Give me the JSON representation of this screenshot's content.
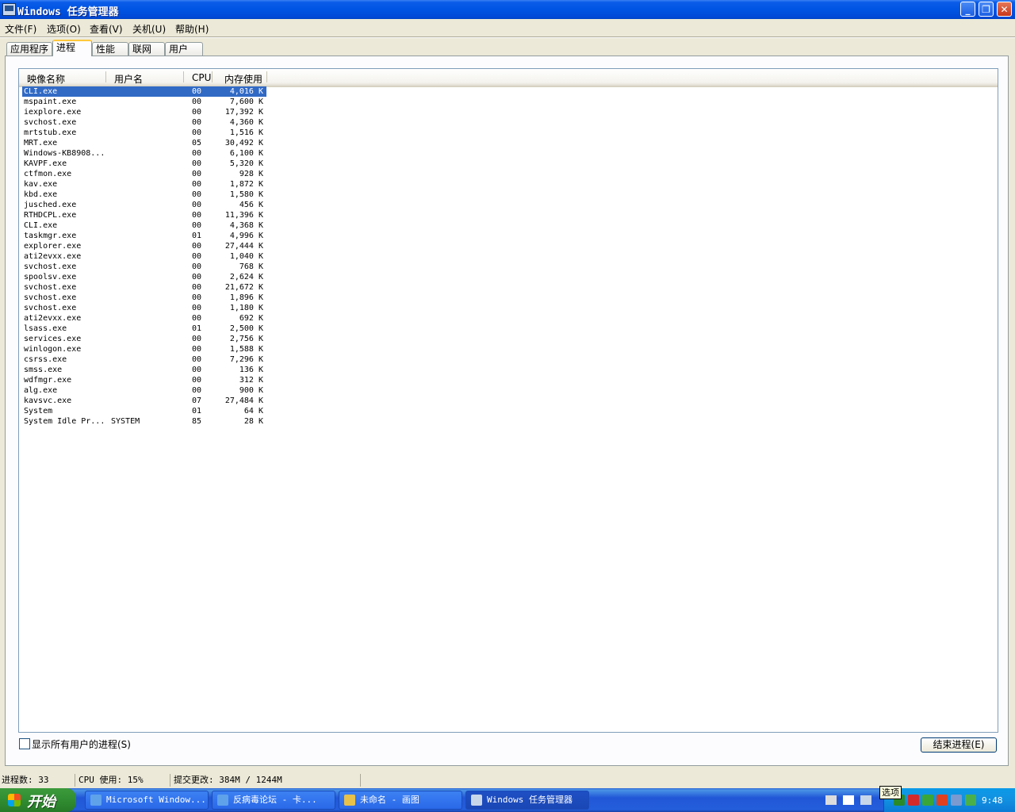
{
  "window": {
    "title": "Windows 任务管理器",
    "minimize": "_",
    "maximize": "❐",
    "close": "✕"
  },
  "menu": [
    "文件(F)",
    "选项(O)",
    "查看(V)",
    "关机(U)",
    "帮助(H)"
  ],
  "tabs": [
    "应用程序",
    "进程",
    "性能",
    "联网",
    "用户"
  ],
  "active_tab": "进程",
  "columns": {
    "name": "映像名称",
    "user": "用户名",
    "cpu": "CPU",
    "mem": "内存使用"
  },
  "processes": [
    {
      "name": "CLI.exe",
      "user": "",
      "cpu": "00",
      "mem": "4,016 K"
    },
    {
      "name": "mspaint.exe",
      "user": "",
      "cpu": "00",
      "mem": "7,600 K"
    },
    {
      "name": "iexplore.exe",
      "user": "",
      "cpu": "00",
      "mem": "17,392 K"
    },
    {
      "name": "svchost.exe",
      "user": "",
      "cpu": "00",
      "mem": "4,360 K"
    },
    {
      "name": "mrtstub.exe",
      "user": "",
      "cpu": "00",
      "mem": "1,516 K"
    },
    {
      "name": "MRT.exe",
      "user": "",
      "cpu": "05",
      "mem": "30,492 K"
    },
    {
      "name": "Windows-KB8908...",
      "user": "",
      "cpu": "00",
      "mem": "6,100 K"
    },
    {
      "name": "KAVPF.exe",
      "user": "",
      "cpu": "00",
      "mem": "5,320 K"
    },
    {
      "name": "ctfmon.exe",
      "user": "",
      "cpu": "00",
      "mem": "928 K"
    },
    {
      "name": "kav.exe",
      "user": "",
      "cpu": "00",
      "mem": "1,872 K"
    },
    {
      "name": "kbd.exe",
      "user": "",
      "cpu": "00",
      "mem": "1,580 K"
    },
    {
      "name": "jusched.exe",
      "user": "",
      "cpu": "00",
      "mem": "456 K"
    },
    {
      "name": "RTHDCPL.exe",
      "user": "",
      "cpu": "00",
      "mem": "11,396 K"
    },
    {
      "name": "CLI.exe",
      "user": "",
      "cpu": "00",
      "mem": "4,368 K"
    },
    {
      "name": "taskmgr.exe",
      "user": "",
      "cpu": "01",
      "mem": "4,996 K"
    },
    {
      "name": "explorer.exe",
      "user": "",
      "cpu": "00",
      "mem": "27,444 K"
    },
    {
      "name": "ati2evxx.exe",
      "user": "",
      "cpu": "00",
      "mem": "1,040 K"
    },
    {
      "name": "svchost.exe",
      "user": "",
      "cpu": "00",
      "mem": "768 K"
    },
    {
      "name": "spoolsv.exe",
      "user": "",
      "cpu": "00",
      "mem": "2,624 K"
    },
    {
      "name": "svchost.exe",
      "user": "",
      "cpu": "00",
      "mem": "21,672 K"
    },
    {
      "name": "svchost.exe",
      "user": "",
      "cpu": "00",
      "mem": "1,896 K"
    },
    {
      "name": "svchost.exe",
      "user": "",
      "cpu": "00",
      "mem": "1,180 K"
    },
    {
      "name": "ati2evxx.exe",
      "user": "",
      "cpu": "00",
      "mem": "692 K"
    },
    {
      "name": "lsass.exe",
      "user": "",
      "cpu": "01",
      "mem": "2,500 K"
    },
    {
      "name": "services.exe",
      "user": "",
      "cpu": "00",
      "mem": "2,756 K"
    },
    {
      "name": "winlogon.exe",
      "user": "",
      "cpu": "00",
      "mem": "1,588 K"
    },
    {
      "name": "csrss.exe",
      "user": "",
      "cpu": "00",
      "mem": "7,296 K"
    },
    {
      "name": "smss.exe",
      "user": "",
      "cpu": "00",
      "mem": "136 K"
    },
    {
      "name": "wdfmgr.exe",
      "user": "",
      "cpu": "00",
      "mem": "312 K"
    },
    {
      "name": "alg.exe",
      "user": "",
      "cpu": "00",
      "mem": "900 K"
    },
    {
      "name": "kavsvc.exe",
      "user": "",
      "cpu": "07",
      "mem": "27,484 K"
    },
    {
      "name": "System",
      "user": "",
      "cpu": "01",
      "mem": "64 K"
    },
    {
      "name": "System Idle Pr...",
      "user": "SYSTEM",
      "cpu": "85",
      "mem": "28 K"
    }
  ],
  "selected_index": 0,
  "show_all_users": {
    "label": "显示所有用户的进程(S)",
    "checked": false
  },
  "end_process_button": "结束进程(E)",
  "status": {
    "process_count": "进程数: 33",
    "cpu_usage": "CPU 使用: 15%",
    "commit": "提交更改: 384M / 1244M"
  },
  "taskbar": {
    "start": "开始",
    "tasks": [
      {
        "label": "Microsoft Window...",
        "icon": "ie-icon",
        "color": "#5fa2ea"
      },
      {
        "label": "反病毒论坛 - 卡...",
        "icon": "ie-icon",
        "color": "#5fa2ea"
      },
      {
        "label": "未命名 - 画图",
        "icon": "paint-icon",
        "color": "#e8c14a"
      },
      {
        "label": "Windows 任务管理器",
        "icon": "taskmgr-icon",
        "color": "#c8d6ea"
      }
    ],
    "active_task": 3,
    "tooltip": "选项",
    "clock": "9:48"
  },
  "colors": {
    "selection": "#316ac5",
    "titlebar": "#0054e3",
    "taskbar": "#245edb",
    "start": "#2f8a2f"
  }
}
